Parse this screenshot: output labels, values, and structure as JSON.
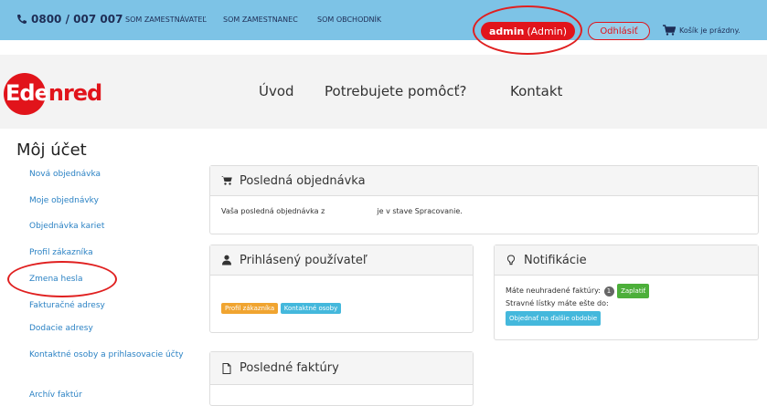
{
  "topbar": {
    "phone": "0800 / 007 007",
    "links": [
      "SOM ZAMESTNÁVATEĽ",
      "SOM ZAMESTNANEC",
      "SOM OBCHODNÍK"
    ],
    "admin_user": "admin",
    "admin_role": "(Admin)",
    "logout": "Odhlásiť",
    "cart": "Košík je prázdny."
  },
  "header": {
    "logo": "Edenred",
    "nav": [
      "Úvod",
      "Potrebujete pomôcť?",
      "Kontakt"
    ]
  },
  "sidebar": {
    "title": "Môj účet",
    "items": [
      "Nová objednávka",
      "Moje objednávky",
      "Objednávka kariet",
      "Profil zákazníka",
      "Zmena hesla",
      "Fakturačné adresy",
      "Dodacie adresy",
      "Kontaktné osoby a prihlasovacie účty",
      "Archív faktúr"
    ]
  },
  "panels": {
    "last_order": {
      "title": "Posledná objednávka",
      "text_prefix": "Vaša posledná objednávka z",
      "text_suffix": "je v stave Spracovanie."
    },
    "logged_user": {
      "title": "Prihlásený používateľ",
      "btn_profile": "Profil zákazníka",
      "btn_contacts": "Kontaktné osoby"
    },
    "notifications": {
      "title": "Notifikácie",
      "line1": "Máte neuhradené faktúry:",
      "count": "1",
      "pay": "Zaplatiť",
      "line2": "Stravné lístky máte ešte do:",
      "order_next": "Objednať na ďalšie obdobie"
    },
    "last_invoices": {
      "title": "Posledné faktúry"
    }
  },
  "colors": {
    "topbar": "#7dc3e6",
    "brand_red": "#e1141b",
    "link_blue": "#2b82c4"
  }
}
